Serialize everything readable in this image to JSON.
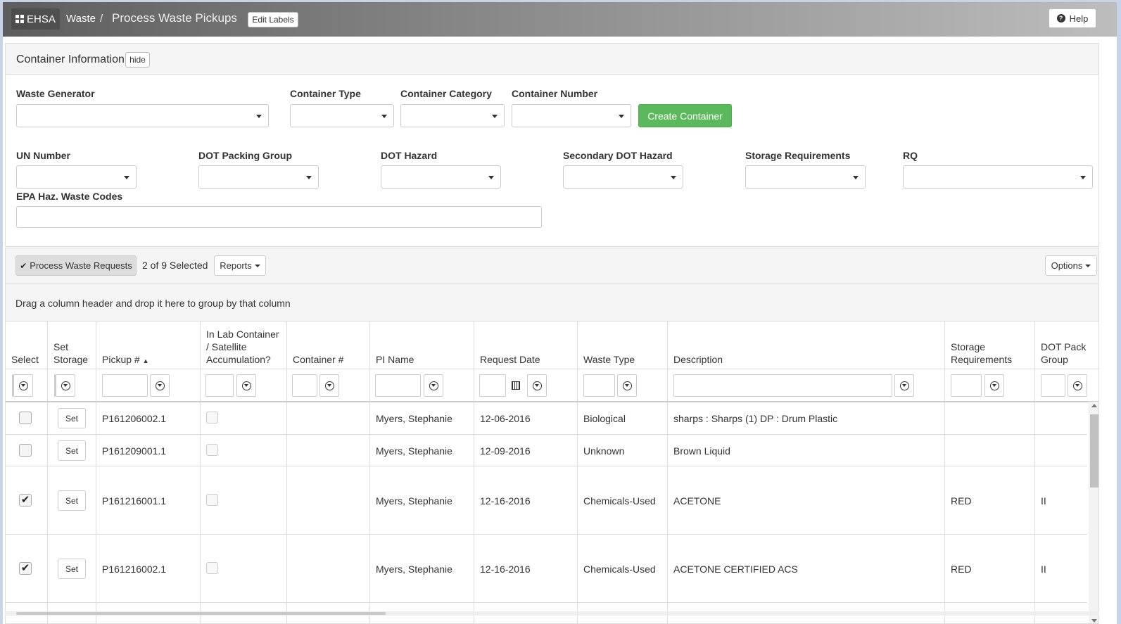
{
  "navbar": {
    "brand": "EHSA",
    "crumb_module": "Waste",
    "crumb_separator": "/",
    "crumb_page": "Process Waste Pickups",
    "edit_labels": "Edit Labels",
    "help": "Help"
  },
  "container_panel": {
    "title": "Container Information",
    "hide_label": "hide",
    "fields": {
      "waste_generator": "Waste Generator",
      "container_type": "Container Type",
      "container_category": "Container Category",
      "container_number": "Container Number",
      "un_number": "UN Number",
      "dot_packing_group": "DOT Packing Group",
      "dot_hazard": "DOT Hazard",
      "secondary_dot_hazard": "Secondary DOT Hazard",
      "storage_requirements": "Storage Requirements",
      "rq": "RQ",
      "epa_codes": "EPA Haz. Waste Codes"
    },
    "create_button": "Create Container"
  },
  "toolbar": {
    "process_label": "Process Waste Requests",
    "selected_text": "2 of 9 Selected",
    "reports_label": "Reports",
    "options_label": "Options"
  },
  "group_hint": "Drag a column header and drop it here to group by that column",
  "grid": {
    "headers": {
      "select": "Select",
      "set_storage_1": "Set",
      "set_storage_2": "Storage",
      "pickup": "Pickup #",
      "sort_indicator": "▲",
      "inlab_1": "In Lab Container",
      "inlab_2": "/ Satellite",
      "inlab_3": "Accumulation?",
      "container": "Container #",
      "pi_name": "PI Name",
      "request_date": "Request Date",
      "waste_type": "Waste Type",
      "description": "Description",
      "storage_1": "Storage",
      "storage_2": "Requirements",
      "dotpack_1": "DOT Pack",
      "dotpack_2": "Group"
    },
    "set_label": "Set",
    "rows": [
      {
        "checked": "",
        "pickup": "P161206002.1",
        "pi": "Myers, Stephanie",
        "date": "12-06-2016",
        "type": "Biological",
        "desc": "sharps : Sharps (1) DP : Drum Plastic",
        "storage": "",
        "dotpack": ""
      },
      {
        "checked": "",
        "pickup": "P161209001.1",
        "pi": "Myers, Stephanie",
        "date": "12-09-2016",
        "type": "Unknown",
        "desc": "Brown Liquid",
        "storage": "",
        "dotpack": ""
      },
      {
        "checked": "✔",
        "pickup": "P161216001.1",
        "pi": "Myers, Stephanie",
        "date": "12-16-2016",
        "type": "Chemicals-Used",
        "desc": "ACETONE",
        "storage": "RED",
        "dotpack": "II"
      },
      {
        "checked": "✔",
        "pickup": "P161216002.1",
        "pi": "Myers, Stephanie",
        "date": "12-16-2016",
        "type": "Chemicals-Used",
        "desc": "ACETONE CERTIFIED ACS",
        "storage": "RED",
        "dotpack": "II"
      }
    ]
  },
  "colors": {
    "green_button": "#5cb85c",
    "panel_bg": "#f5f5f5",
    "border": "#dddddd"
  }
}
